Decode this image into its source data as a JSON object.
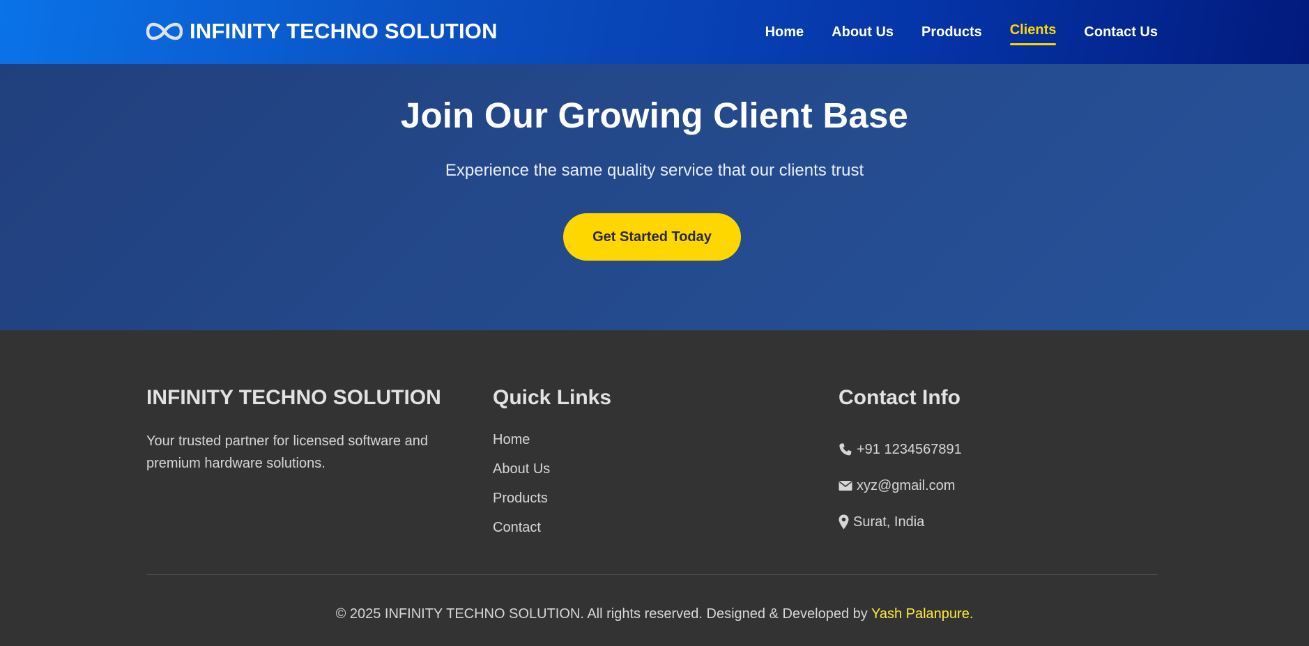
{
  "header": {
    "brand_icon": "infinity-icon",
    "brand_name": "INFINITY TECHNO SOLUTION",
    "nav": [
      {
        "label": "Home",
        "active": false
      },
      {
        "label": "About Us",
        "active": false
      },
      {
        "label": "Products",
        "active": false
      },
      {
        "label": "Clients",
        "active": true
      },
      {
        "label": "Contact Us",
        "active": false
      }
    ]
  },
  "hero": {
    "title": "Join Our Growing Client Base",
    "subtitle": "Experience the same quality service that our clients trust",
    "cta_label": "Get Started Today"
  },
  "footer": {
    "about": {
      "title": "INFINITY TECHNO SOLUTION",
      "text": "Your trusted partner for licensed software and premium hardware solutions."
    },
    "quick_links": {
      "title": "Quick Links",
      "items": [
        "Home",
        "About Us",
        "Products",
        "Contact"
      ]
    },
    "contact": {
      "title": "Contact Info",
      "items": [
        {
          "icon": "phone-icon",
          "text": "+91 1234567891"
        },
        {
          "icon": "envelope-icon",
          "text": "xyz@gmail.com"
        },
        {
          "icon": "map-marker-icon",
          "text": "Surat, India"
        }
      ]
    },
    "copyright_text": "© 2025 INFINITY TECHNO SOLUTION. All rights reserved. Designed & Developed by ",
    "developer_name": "Yash Palanpure."
  },
  "colors": {
    "accent_yellow": "#ffd700",
    "developer_link": "#ffeb3b",
    "footer_bg": "#333333",
    "hero_bg": "#244a8c"
  }
}
